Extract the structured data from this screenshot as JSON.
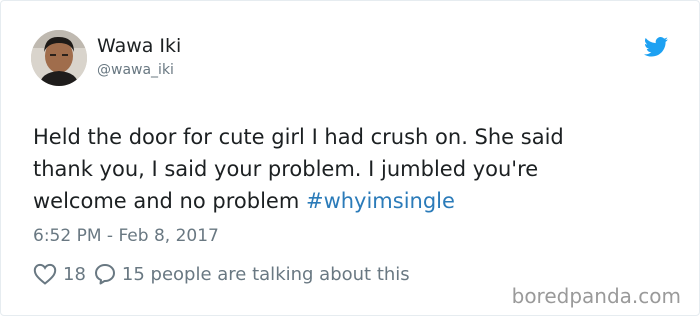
{
  "user": {
    "display_name": "Wawa Iki",
    "handle": "@wawa_iki"
  },
  "tweet": {
    "line1": "Held the door for cute girl I had crush on. She said",
    "line2": "thank you, I said your problem. I jumbled you're",
    "line3_text": "welcome and no problem ",
    "hashtag": "#whyimsingle",
    "timestamp": "6:52 PM - Feb 8, 2017"
  },
  "engagement": {
    "likes": "18",
    "talking": "15 people are talking about this"
  },
  "watermark": "boredpanda.com",
  "colors": {
    "link": "#2b7bb9",
    "twitter_blue": "#1da1f2",
    "muted": "#697882"
  },
  "icons": {
    "brand": "twitter-bird-icon",
    "like": "heart-icon",
    "reply": "speech-bubble-icon"
  }
}
